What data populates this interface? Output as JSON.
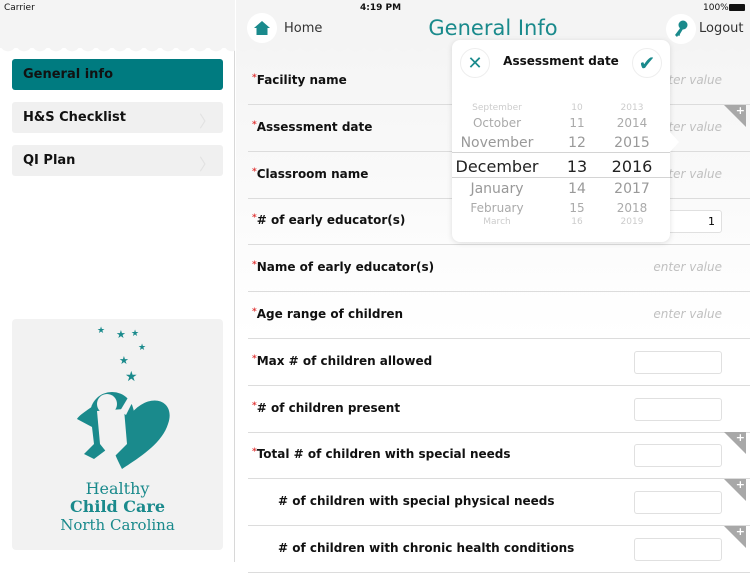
{
  "status": {
    "carrier": "Carrier",
    "time": "4:19 PM",
    "battery": "100%"
  },
  "sidebar": {
    "items": [
      {
        "label": "General info",
        "active": true
      },
      {
        "label": "H&S Checklist"
      },
      {
        "label": "QI Plan"
      }
    ],
    "logo": {
      "line1": "Healthy",
      "line2": "Child Care",
      "line3": "North Carolina"
    }
  },
  "header": {
    "home_label": "Home",
    "title": "General Info",
    "logout_label": "Logout",
    "icons": [
      "home-icon",
      "key-icon"
    ]
  },
  "colors": {
    "accent": "#007b80",
    "title": "#1a8a8c",
    "required": "#e03a3a"
  },
  "form": {
    "rows": [
      {
        "label": "Facility name",
        "required": true,
        "placeholder": "enter value"
      },
      {
        "label": "Assessment date",
        "required": true,
        "placeholder": "enter value",
        "plus": true
      },
      {
        "label": "Classroom name",
        "required": true,
        "placeholder": "enter value"
      },
      {
        "label": "# of early educator(s)",
        "required": true,
        "value": "1"
      },
      {
        "label": "Name of early educator(s)",
        "required": true,
        "placeholder": "enter value"
      },
      {
        "label": "Age range of children",
        "required": true,
        "placeholder": "enter value"
      },
      {
        "label": "Max # of children allowed",
        "required": true,
        "value": ""
      },
      {
        "label": "# of children present",
        "required": true,
        "value": ""
      },
      {
        "label": "Total # of children with special needs",
        "required": true,
        "value": "",
        "plus": true
      },
      {
        "label": "# of children with special physical needs",
        "indent": true,
        "value": "",
        "plus": true
      },
      {
        "label": "# of children with chronic health conditions",
        "indent": true,
        "value": "",
        "plus": true
      }
    ]
  },
  "picker": {
    "title": "Assessment date",
    "months": [
      "September",
      "October",
      "November",
      "December",
      "January",
      "February",
      "March"
    ],
    "days": [
      "10",
      "11",
      "12",
      "13",
      "14",
      "15",
      "16"
    ],
    "years": [
      "2013",
      "2014",
      "2015",
      "2016",
      "2017",
      "2018",
      "2019"
    ],
    "selected": {
      "month": "December",
      "day": "13",
      "year": "2016"
    }
  }
}
